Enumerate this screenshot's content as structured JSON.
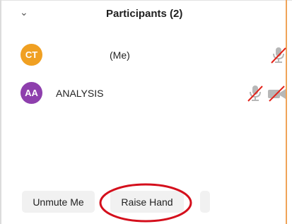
{
  "panel": {
    "title": "Participants (2)",
    "collapse_glyph": "⌄",
    "accent_color": "#f0a358"
  },
  "participants": [
    {
      "initials": "CT",
      "name": "(Me)",
      "avatar_color": "#f0a022",
      "mic_state": "muted",
      "video_icon": false
    },
    {
      "initials": "AA",
      "name": "ANALYSIS",
      "avatar_color": "#8e3fad",
      "mic_state": "muted",
      "video_icon": true,
      "video_state": "off"
    }
  ],
  "footer": {
    "unmute_label": "Unmute Me",
    "raise_hand_label": "Raise Hand"
  },
  "annotation": {
    "shape": "ellipse",
    "color": "#d40f1c",
    "target": "raise-hand-button"
  }
}
